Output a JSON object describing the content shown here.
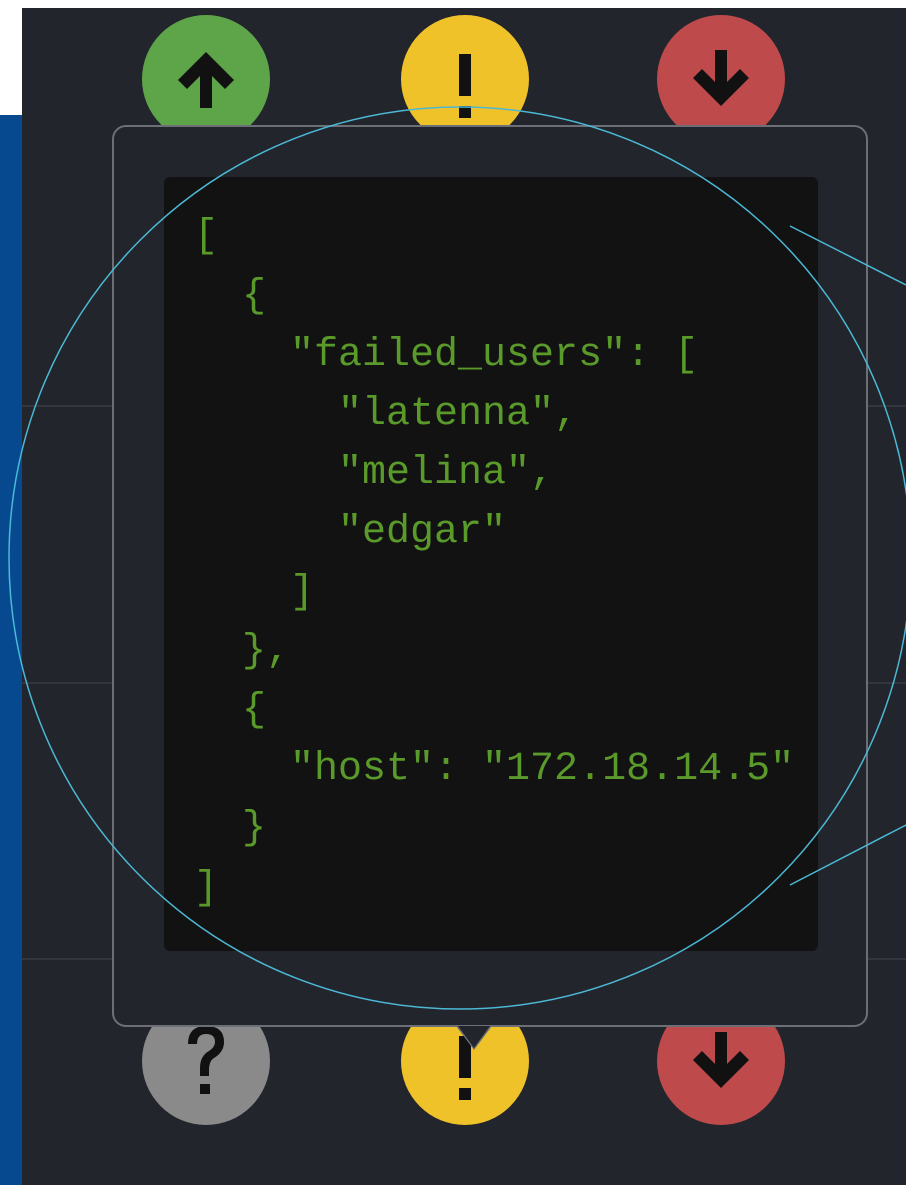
{
  "colors": {
    "background": "#22252b",
    "left_band": "#07498f",
    "code_bg": "#121212",
    "code_text": "#5a9a2b",
    "status_up": "#5ea54a",
    "status_warning": "#f0c22a",
    "status_down": "#bf4a4b",
    "status_unknown": "#8a8a8a",
    "magnifier_ring": "#4bb8d6"
  },
  "status_icons_top": [
    {
      "icon": "arrow-up-icon",
      "status": "up"
    },
    {
      "icon": "exclamation-icon",
      "status": "warning"
    },
    {
      "icon": "arrow-down-icon",
      "status": "down"
    }
  ],
  "status_icons_bottom": [
    {
      "icon": "question-icon",
      "status": "unknown"
    },
    {
      "icon": "exclamation-icon",
      "status": "warning"
    },
    {
      "icon": "arrow-down-icon",
      "status": "down"
    }
  ],
  "popup": {
    "code_lines": [
      "[",
      "  {",
      "    \"failed_users\": [",
      "      \"latenna\",",
      "      \"melina\",",
      "      \"edgar\"",
      "    ]",
      "  },",
      "  {",
      "    \"host\": \"172.18.14.5\"",
      "  }",
      "]"
    ]
  }
}
